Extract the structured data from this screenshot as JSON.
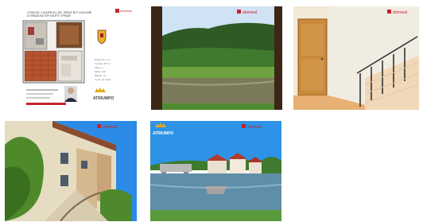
{
  "gallery": {
    "brand": "domreal",
    "brand_suffix": ".cz",
    "agency": "ATRIUMPO",
    "items": [
      {
        "name": "floor-plan",
        "title_line1": "3 POKOJE, 2 KOUPELNY, WC, ČERNÝ BYT, KUCHYNĚ",
        "title_line2": "A TERASA NA TOP KOUPIT V PRAZE",
        "side_lines": [
          "Dispozice: 4+1",
          "Výměra: 95 m²",
          "Patro: 1.",
          "Sklep: ano",
          "Balkon: ne",
          "Cena: na dotaz"
        ]
      },
      {
        "name": "window-river-view"
      },
      {
        "name": "staircase"
      },
      {
        "name": "street-houses"
      },
      {
        "name": "river-village"
      }
    ]
  },
  "colors": {
    "brand_red": "#c4232f",
    "sky": "#2d8ae0",
    "grass": "#5b9a3a"
  }
}
